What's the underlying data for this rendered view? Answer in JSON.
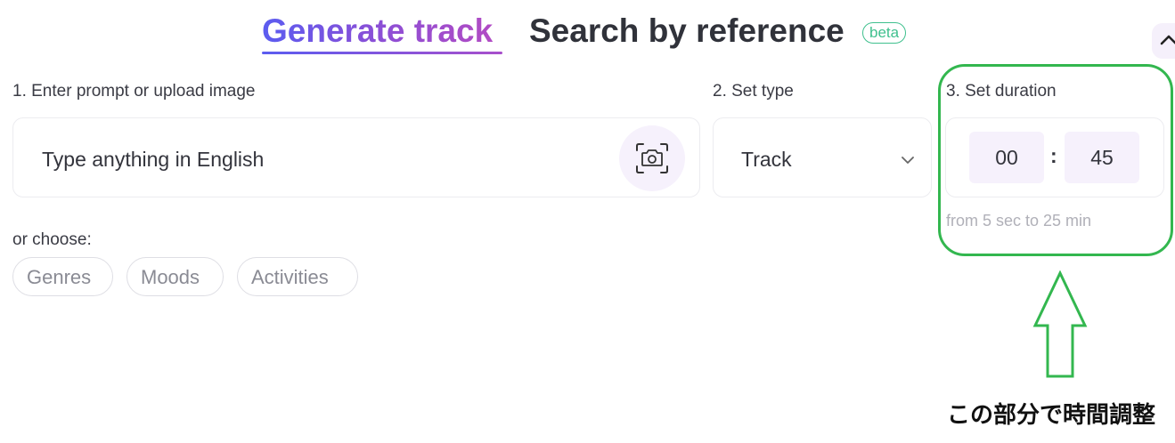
{
  "tabs": {
    "generate": "Generate track",
    "search": "Search by reference",
    "beta_badge": "beta"
  },
  "prompt": {
    "label": "1. Enter prompt or upload image",
    "placeholder": "Type anything in English"
  },
  "type": {
    "label": "2. Set type",
    "value": "Track"
  },
  "duration": {
    "label": "3. Set duration",
    "minutes": "00",
    "colon": ":",
    "seconds": "45",
    "hint": "from 5 sec to 25 min"
  },
  "choose": {
    "label": "or choose:",
    "chips": [
      "Genres",
      "Moods",
      "Activities"
    ]
  },
  "annotation": {
    "note": "この部分で時間調整"
  },
  "colors": {
    "accent_gradient_start": "#5b5cf0",
    "accent_gradient_end": "#b14bc4",
    "beta_green": "#3fc08e",
    "highlight_green": "#33b74f"
  },
  "icons": [
    "chevron-up-icon",
    "camera-icon",
    "chevron-down-icon",
    "arrow-up-outline-icon"
  ]
}
